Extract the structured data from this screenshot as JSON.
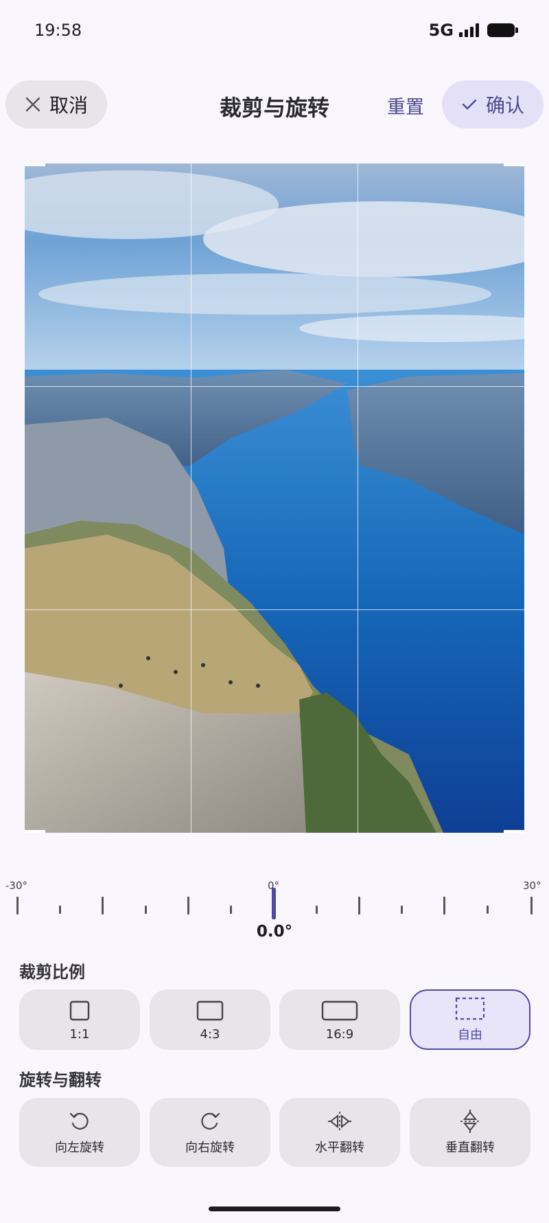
{
  "status_bar": {
    "time": "19:58",
    "network": "5G"
  },
  "header": {
    "cancel_label": "取消",
    "title": "裁剪与旋转",
    "reset_label": "重置",
    "confirm_label": "确认"
  },
  "ruler": {
    "min_label": "-30°",
    "mid_label": "0°",
    "max_label": "30°",
    "current_value": "0.0°"
  },
  "crop_ratio": {
    "section_title": "裁剪比例",
    "options": [
      {
        "label": "1:1",
        "icon": "square-icon"
      },
      {
        "label": "4:3",
        "icon": "rect-4-3-icon"
      },
      {
        "label": "16:9",
        "icon": "rect-16-9-icon"
      },
      {
        "label": "自由",
        "icon": "free-crop-icon",
        "selected": true
      }
    ]
  },
  "transform": {
    "section_title": "旋转与翻转",
    "options": [
      {
        "label": "向左旋转",
        "icon": "rotate-left-icon"
      },
      {
        "label": "向右旋转",
        "icon": "rotate-right-icon"
      },
      {
        "label": "水平翻转",
        "icon": "flip-horizontal-icon"
      },
      {
        "label": "垂直翻转",
        "icon": "flip-vertical-icon"
      }
    ]
  },
  "colors": {
    "accent": "#4f4aa5",
    "background": "#f9f7fd",
    "tile": "#e7e4ea"
  }
}
